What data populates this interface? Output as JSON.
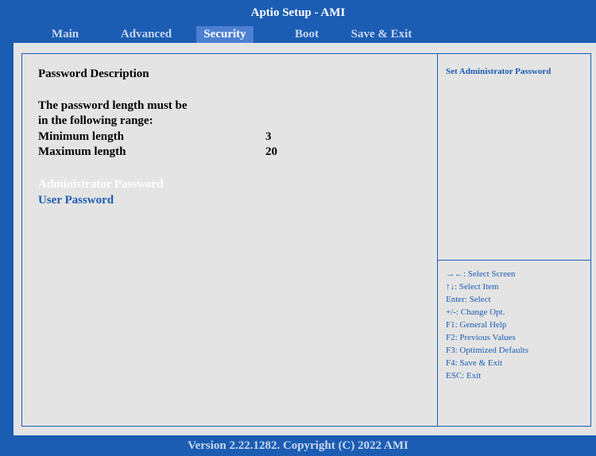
{
  "title": "Aptio Setup - AMI",
  "tabs": [
    "Main",
    "Advanced",
    "Security",
    "Boot",
    "Save & Exit"
  ],
  "active_tab": "Security",
  "main": {
    "heading": "Password Description",
    "desc_line1": "The password length must be",
    "desc_line2": "in the following range:",
    "min_label": "Minimum length",
    "min_value": "3",
    "max_label": "Maximum length",
    "max_value": "20",
    "items": [
      "Administrator Password",
      "User Password"
    ],
    "selected_item": "Administrator Password"
  },
  "help": {
    "text": "Set Administrator Password",
    "keys": [
      "→←: Select Screen",
      "↑↓: Select Item",
      "Enter: Select",
      "+/-: Change Opt.",
      "F1: General Help",
      "F2: Previous Values",
      "F3: Optimized Defaults",
      "F4: Save & Exit",
      "ESC: Exit"
    ]
  },
  "footer": "Version 2.22.1282. Copyright (C) 2022 AMI",
  "colors": {
    "frame_blue": "#1b5db3",
    "panel_gray": "#e4e4e4",
    "active_tab": "#4d80d2",
    "inactive_text": "#c9d6ee"
  }
}
